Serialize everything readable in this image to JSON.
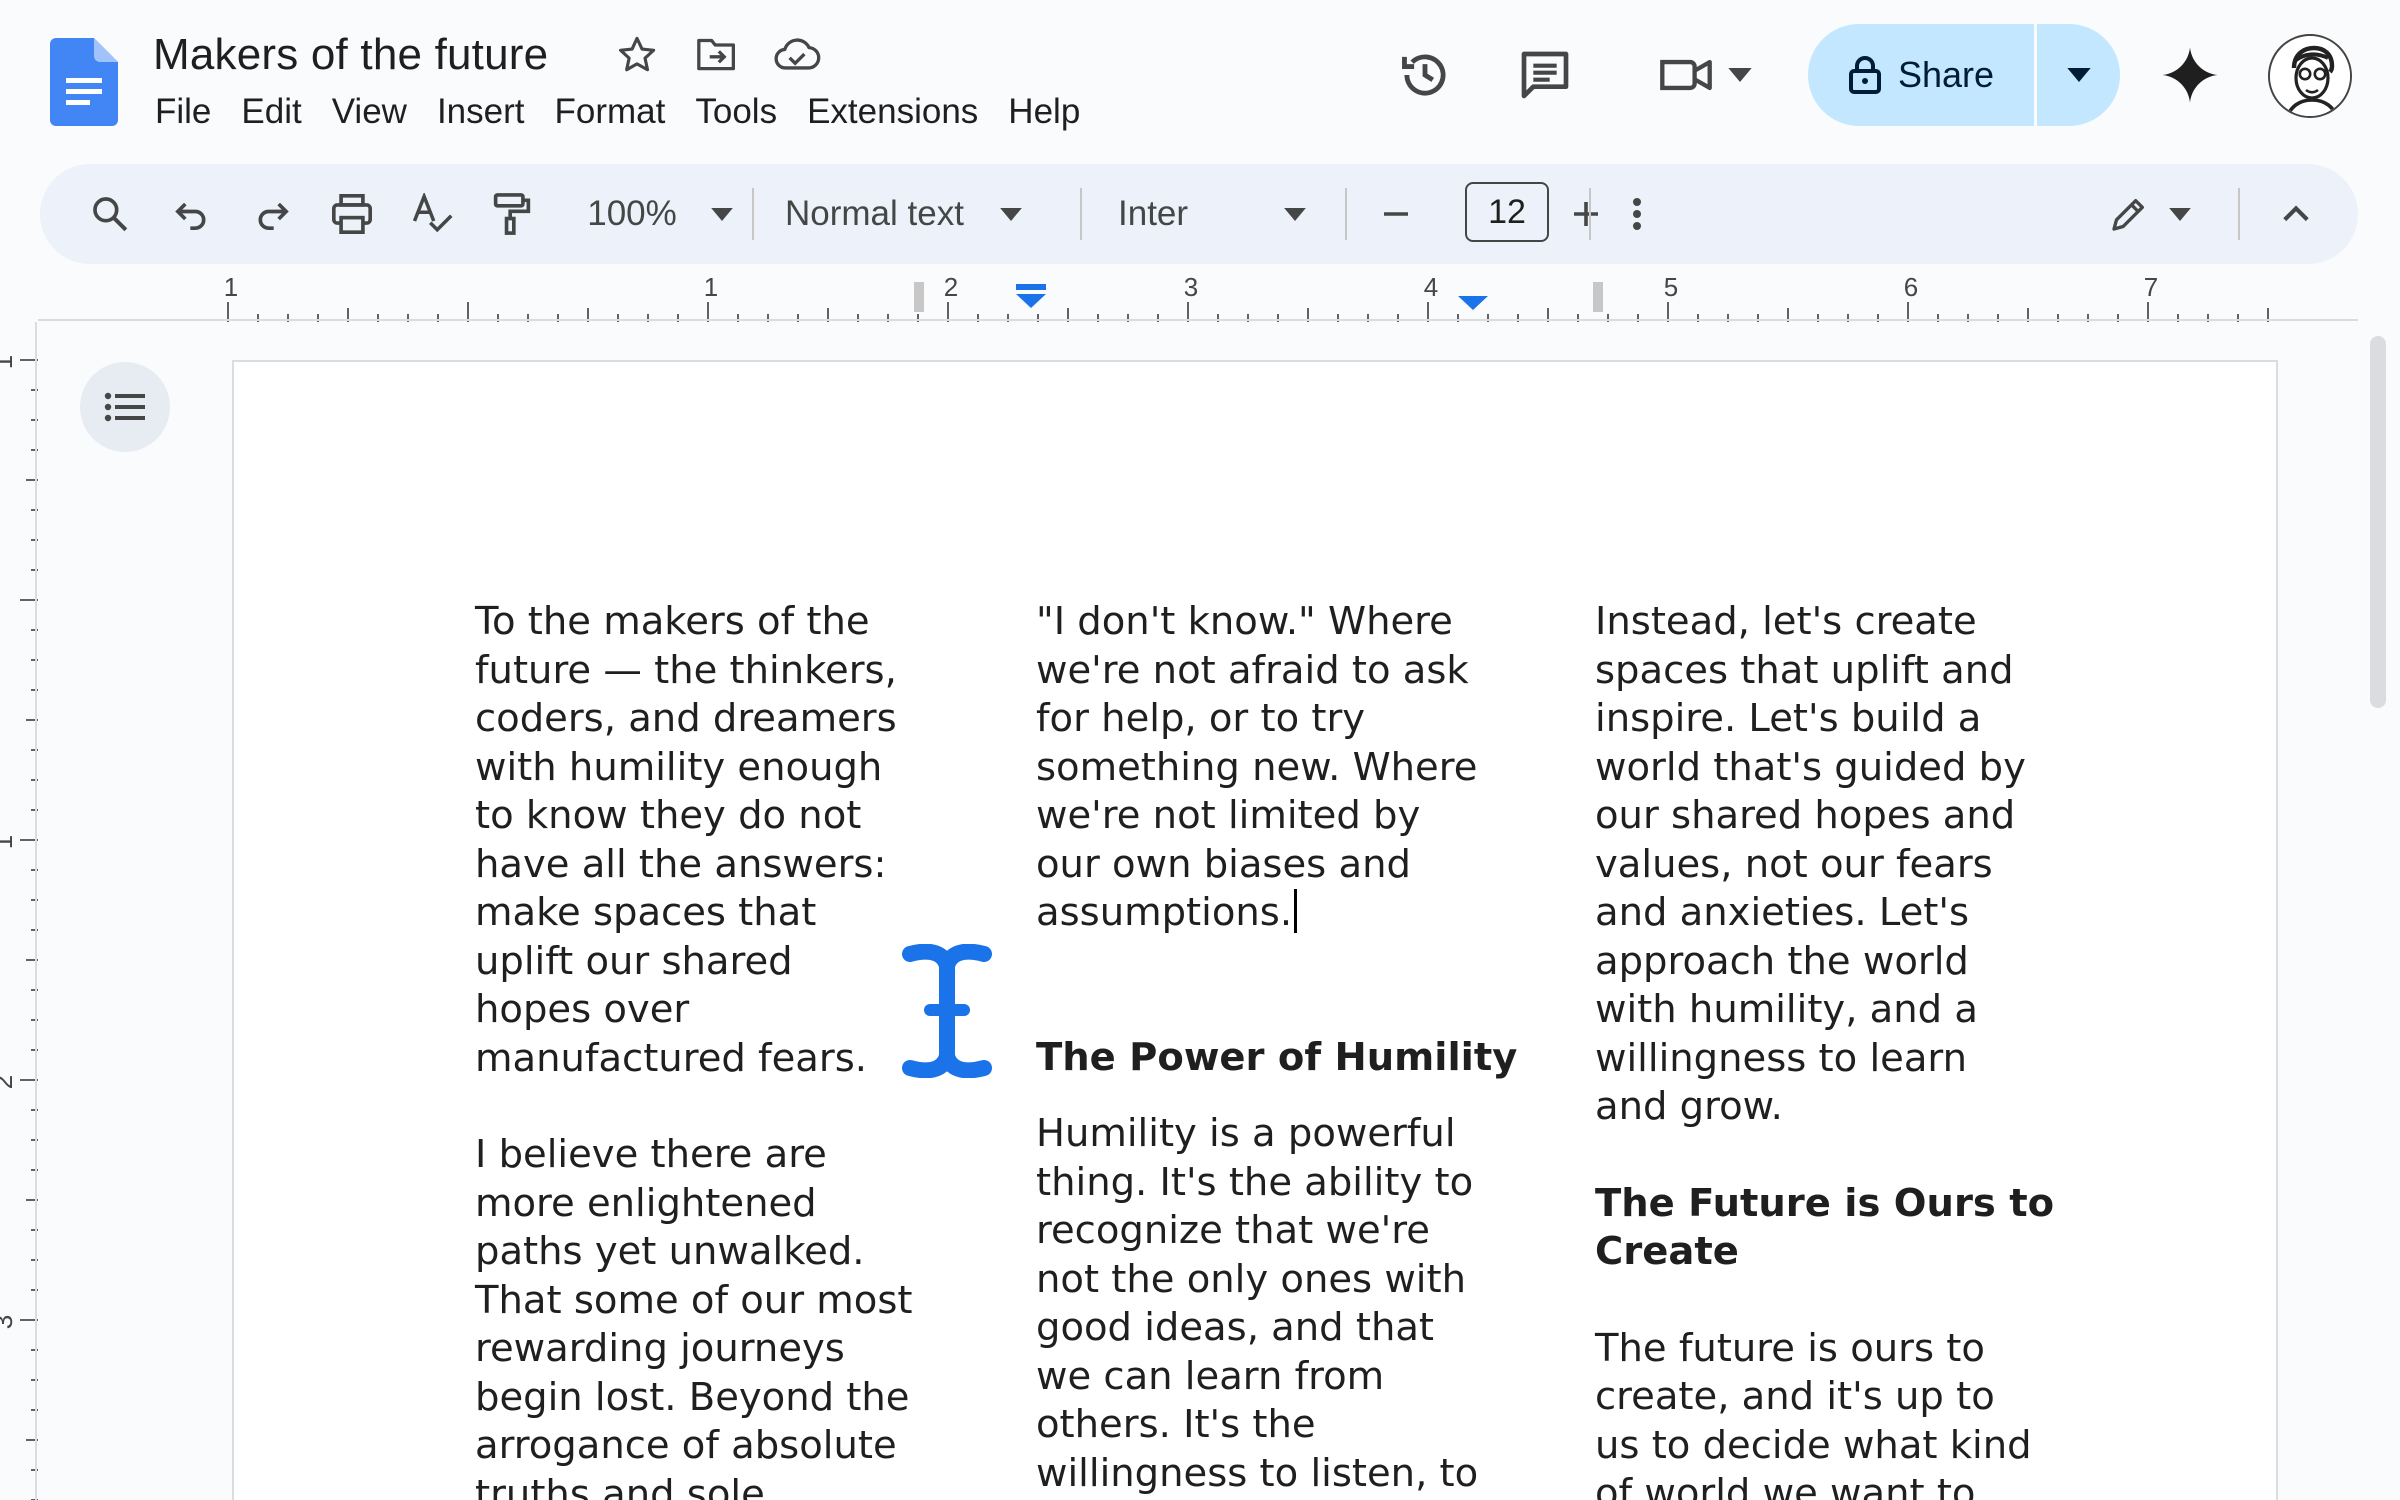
{
  "app": {
    "title": "Makers of the future",
    "menu": [
      "File",
      "Edit",
      "View",
      "Insert",
      "Format",
      "Tools",
      "Extensions",
      "Help"
    ],
    "share_label": "Share",
    "accent_color": "#1a73e8",
    "share_bg": "#c2e7ff"
  },
  "toolbar": {
    "zoom": "100%",
    "style": "Normal text",
    "font": "Inter",
    "font_size": "12"
  },
  "ruler": {
    "h_labels": [
      "1",
      "1",
      "2",
      "3",
      "4",
      "5",
      "6",
      "7"
    ],
    "v_labels": [
      "1",
      "1",
      "2",
      "3"
    ]
  },
  "document": {
    "col1": {
      "p1": "To the makers of the\nfuture — the thinkers,\ncoders, and dreamers\nwith humility enough\nto know they do not\nhave all the answers:\nmake spaces that\nuplift our shared\nhopes over\nmanufactured fears.",
      "p2": "I believe there are\nmore enlightened\npaths yet unwalked.\nThat some of our most\nrewarding journeys\nbegin lost. Beyond the\narrogance of absolute\ntruths and sole"
    },
    "col2": {
      "p1": "\"I don't know.\" Where\nwe're not afraid to ask\nfor help, or to try\nsomething new. Where\nwe're not limited by\nour own biases and\nassumptions.",
      "h1": "The Power of Humility",
      "p2": "Humility is a powerful\nthing. It's the ability to\nrecognize that we're\nnot the only ones with\ngood ideas, and that\nwe can learn from\nothers. It's the\nwillingness to listen, to"
    },
    "col3": {
      "p1": "Instead, let's create\nspaces that uplift and\ninspire. Let's build a\nworld that's guided by\nour shared hopes and\nvalues, not our fears\nand anxieties. Let's\napproach the world\nwith humility, and a\nwillingness to learn\nand grow.",
      "h1": "The Future is Ours to\nCreate",
      "p2": "The future is ours to\ncreate, and it's up to\nus to decide what kind\nof world we want to"
    }
  },
  "icons": {
    "title": [
      "star-icon",
      "move-to-folder-icon",
      "cloud-saved-icon"
    ],
    "header": [
      "version-history-icon",
      "comments-icon",
      "meet-icon",
      "lock-icon",
      "gemini-icon"
    ],
    "toolbar": [
      "search-icon",
      "undo-icon",
      "redo-icon",
      "print-icon",
      "spellcheck-icon",
      "paint-format-icon",
      "more-options-icon",
      "editing-mode-icon",
      "collapse-toolbar-icon"
    ]
  }
}
